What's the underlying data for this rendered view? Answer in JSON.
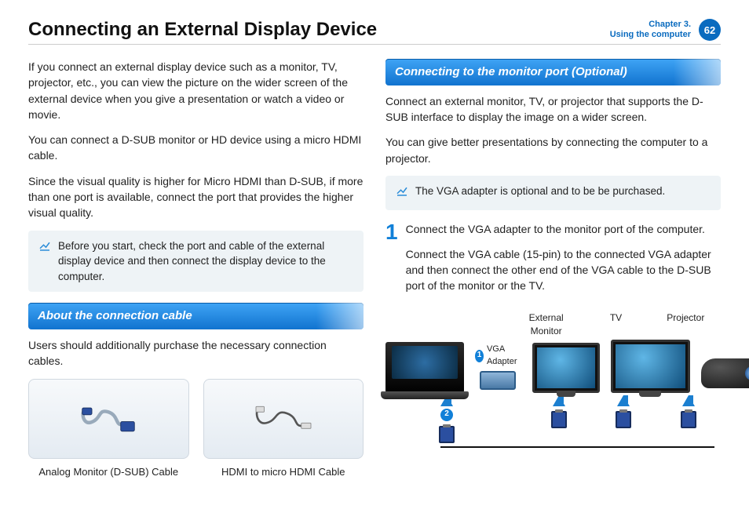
{
  "header": {
    "title": "Connecting an External Display Device",
    "chapter_line1": "Chapter 3.",
    "chapter_line2": "Using the computer",
    "page_number": "62"
  },
  "left": {
    "p1": "If you connect an external display device such as a monitor, TV, projector, etc., you can view the picture on the wider screen of the external device when you give a presentation or watch a video or movie.",
    "p2": "You can connect a D-SUB monitor or HD device using a micro HDMI cable.",
    "p3": "Since the visual quality is higher for Micro HDMI than D-SUB, if more than one port is available, connect the port that provides the higher visual quality.",
    "note": "Before you start, check the port and cable of the external display device and then connect the display device to the computer.",
    "section": "About the connection cable",
    "p4": "Users should additionally purchase the necessary connection cables.",
    "cable1": "Analog Monitor (D-SUB) Cable",
    "cable2": "HDMI to micro HDMI Cable"
  },
  "right": {
    "section": "Connecting to the monitor port (Optional)",
    "p1": "Connect an external monitor, TV, or projector that supports the D-SUB interface to display the image on a wider screen.",
    "p2": "You can give better presentations by connecting the computer to a projector.",
    "note": "The VGA adapter is optional and to be be purchased.",
    "step_num": "1",
    "step_a": "Connect the VGA adapter to the monitor port of the computer.",
    "step_b": "Connect the VGA cable (15-pin) to the connected VGA adapter and then connect the other end of the VGA cable to the D-SUB port of the monitor or the TV.",
    "dia": {
      "ext_monitor": "External Monitor",
      "tv": "TV",
      "projector": "Projector",
      "vga_adapter": "VGA Adapter",
      "b1": "1",
      "b2": "2"
    }
  }
}
